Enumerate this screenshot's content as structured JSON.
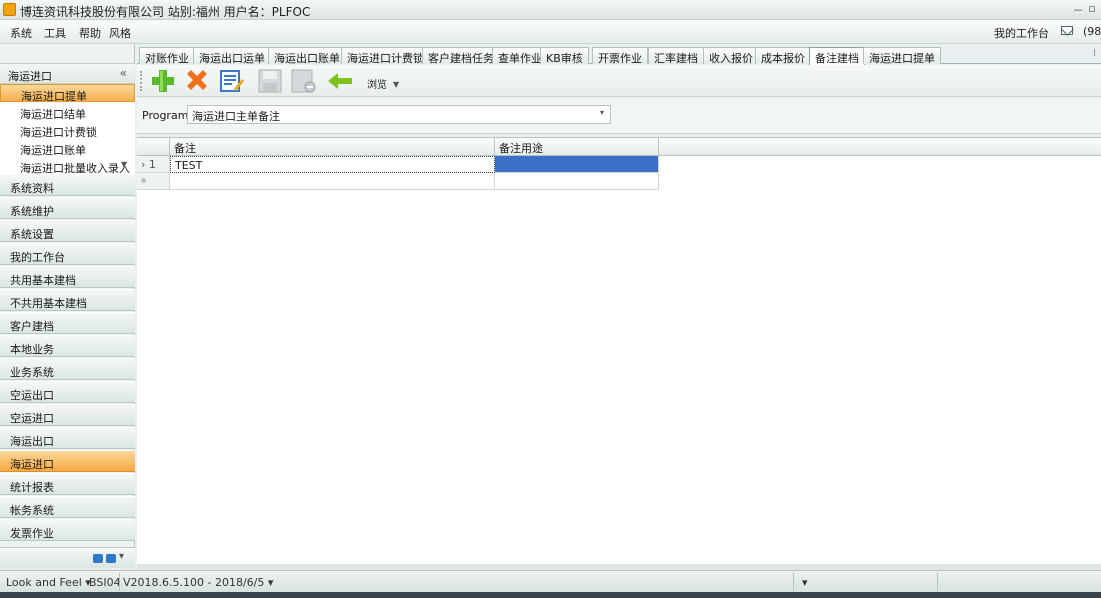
{
  "window": {
    "title": "博连资讯科技股份有限公司 站别:福州   用户名：PLFOC",
    "minimize": "－",
    "maximize": "▫"
  },
  "menu": {
    "items": [
      "系统",
      "工具",
      "帮助",
      "风格"
    ],
    "workspace_label": "我的工作台",
    "mail_count": "(98)"
  },
  "sidebar": {
    "header": "海运进口",
    "collapse": "«",
    "sub_items": [
      {
        "label": "海运进口提单",
        "active": true
      },
      {
        "label": "海运进口结单",
        "active": false
      },
      {
        "label": "海运进口计费锁",
        "active": false
      },
      {
        "label": "海运进口账单",
        "active": false
      },
      {
        "label": "海运进口批量收入录入",
        "active": false
      }
    ],
    "groups": [
      {
        "label": "系统资料",
        "active": false
      },
      {
        "label": "系统维护",
        "active": false
      },
      {
        "label": "系统设置",
        "active": false
      },
      {
        "label": "我的工作台",
        "active": false
      },
      {
        "label": "共用基本建档",
        "active": false
      },
      {
        "label": "不共用基本建档",
        "active": false
      },
      {
        "label": "客户建档",
        "active": false
      },
      {
        "label": "本地业务",
        "active": false
      },
      {
        "label": "业务系统",
        "active": false
      },
      {
        "label": "空运出口",
        "active": false
      },
      {
        "label": "空运进口",
        "active": false
      },
      {
        "label": "海运出口",
        "active": false
      },
      {
        "label": "海运进口",
        "active": true
      },
      {
        "label": "统计报表",
        "active": false
      },
      {
        "label": "帐务系统",
        "active": false
      },
      {
        "label": "发票作业",
        "active": false
      }
    ]
  },
  "tabs": [
    {
      "label": "对账作业",
      "active": false
    },
    {
      "label": "海运出口运单",
      "active": false
    },
    {
      "label": "海运出口账单",
      "active": false
    },
    {
      "label": "海运进口计费锁",
      "active": false
    },
    {
      "label": "客户建档任务",
      "active": false
    },
    {
      "label": "查单作业",
      "active": false
    },
    {
      "label": "KB审核",
      "active": false
    },
    {
      "label": "开票作业",
      "active": false
    },
    {
      "label": "汇率建档",
      "active": false
    },
    {
      "label": "收入报价",
      "active": false
    },
    {
      "label": "成本报价",
      "active": false
    },
    {
      "label": "备注建档",
      "active": true
    },
    {
      "label": "海运进口提单",
      "active": false
    }
  ],
  "toolbar": {
    "browse_label": "浏览"
  },
  "filter": {
    "program_label": "Program",
    "program_value": "海运进口主单备注"
  },
  "grid": {
    "columns": [
      "备注",
      "备注用途"
    ],
    "rows": [
      {
        "num": "1",
        "remark": "TEST",
        "purpose": ""
      }
    ]
  },
  "status": {
    "look_and_feel": "Look and Feel ▾",
    "station": "BSI04",
    "version": "V2018.6.5.100 - 2018/6/5 ▾",
    "extra": "▾"
  },
  "colors": {
    "accent_orange": "#f6b04f",
    "selection_blue": "#3d6fc6",
    "add_green": "#5cb82e",
    "delete_orange": "#f0711c"
  }
}
